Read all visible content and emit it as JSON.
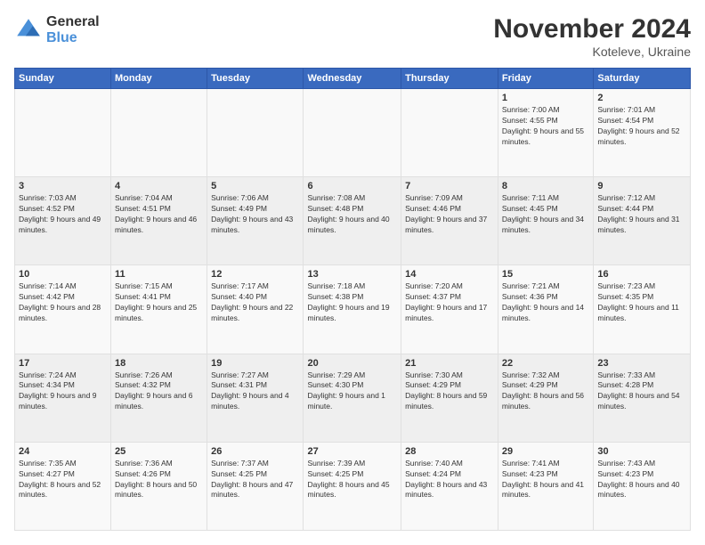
{
  "logo": {
    "general": "General",
    "blue": "Blue"
  },
  "title": "November 2024",
  "location": "Koteleve, Ukraine",
  "days_of_week": [
    "Sunday",
    "Monday",
    "Tuesday",
    "Wednesday",
    "Thursday",
    "Friday",
    "Saturday"
  ],
  "weeks": [
    [
      {
        "day": "",
        "info": ""
      },
      {
        "day": "",
        "info": ""
      },
      {
        "day": "",
        "info": ""
      },
      {
        "day": "",
        "info": ""
      },
      {
        "day": "",
        "info": ""
      },
      {
        "day": "1",
        "info": "Sunrise: 7:00 AM\nSunset: 4:55 PM\nDaylight: 9 hours and 55 minutes."
      },
      {
        "day": "2",
        "info": "Sunrise: 7:01 AM\nSunset: 4:54 PM\nDaylight: 9 hours and 52 minutes."
      }
    ],
    [
      {
        "day": "3",
        "info": "Sunrise: 7:03 AM\nSunset: 4:52 PM\nDaylight: 9 hours and 49 minutes."
      },
      {
        "day": "4",
        "info": "Sunrise: 7:04 AM\nSunset: 4:51 PM\nDaylight: 9 hours and 46 minutes."
      },
      {
        "day": "5",
        "info": "Sunrise: 7:06 AM\nSunset: 4:49 PM\nDaylight: 9 hours and 43 minutes."
      },
      {
        "day": "6",
        "info": "Sunrise: 7:08 AM\nSunset: 4:48 PM\nDaylight: 9 hours and 40 minutes."
      },
      {
        "day": "7",
        "info": "Sunrise: 7:09 AM\nSunset: 4:46 PM\nDaylight: 9 hours and 37 minutes."
      },
      {
        "day": "8",
        "info": "Sunrise: 7:11 AM\nSunset: 4:45 PM\nDaylight: 9 hours and 34 minutes."
      },
      {
        "day": "9",
        "info": "Sunrise: 7:12 AM\nSunset: 4:44 PM\nDaylight: 9 hours and 31 minutes."
      }
    ],
    [
      {
        "day": "10",
        "info": "Sunrise: 7:14 AM\nSunset: 4:42 PM\nDaylight: 9 hours and 28 minutes."
      },
      {
        "day": "11",
        "info": "Sunrise: 7:15 AM\nSunset: 4:41 PM\nDaylight: 9 hours and 25 minutes."
      },
      {
        "day": "12",
        "info": "Sunrise: 7:17 AM\nSunset: 4:40 PM\nDaylight: 9 hours and 22 minutes."
      },
      {
        "day": "13",
        "info": "Sunrise: 7:18 AM\nSunset: 4:38 PM\nDaylight: 9 hours and 19 minutes."
      },
      {
        "day": "14",
        "info": "Sunrise: 7:20 AM\nSunset: 4:37 PM\nDaylight: 9 hours and 17 minutes."
      },
      {
        "day": "15",
        "info": "Sunrise: 7:21 AM\nSunset: 4:36 PM\nDaylight: 9 hours and 14 minutes."
      },
      {
        "day": "16",
        "info": "Sunrise: 7:23 AM\nSunset: 4:35 PM\nDaylight: 9 hours and 11 minutes."
      }
    ],
    [
      {
        "day": "17",
        "info": "Sunrise: 7:24 AM\nSunset: 4:34 PM\nDaylight: 9 hours and 9 minutes."
      },
      {
        "day": "18",
        "info": "Sunrise: 7:26 AM\nSunset: 4:32 PM\nDaylight: 9 hours and 6 minutes."
      },
      {
        "day": "19",
        "info": "Sunrise: 7:27 AM\nSunset: 4:31 PM\nDaylight: 9 hours and 4 minutes."
      },
      {
        "day": "20",
        "info": "Sunrise: 7:29 AM\nSunset: 4:30 PM\nDaylight: 9 hours and 1 minute."
      },
      {
        "day": "21",
        "info": "Sunrise: 7:30 AM\nSunset: 4:29 PM\nDaylight: 8 hours and 59 minutes."
      },
      {
        "day": "22",
        "info": "Sunrise: 7:32 AM\nSunset: 4:29 PM\nDaylight: 8 hours and 56 minutes."
      },
      {
        "day": "23",
        "info": "Sunrise: 7:33 AM\nSunset: 4:28 PM\nDaylight: 8 hours and 54 minutes."
      }
    ],
    [
      {
        "day": "24",
        "info": "Sunrise: 7:35 AM\nSunset: 4:27 PM\nDaylight: 8 hours and 52 minutes."
      },
      {
        "day": "25",
        "info": "Sunrise: 7:36 AM\nSunset: 4:26 PM\nDaylight: 8 hours and 50 minutes."
      },
      {
        "day": "26",
        "info": "Sunrise: 7:37 AM\nSunset: 4:25 PM\nDaylight: 8 hours and 47 minutes."
      },
      {
        "day": "27",
        "info": "Sunrise: 7:39 AM\nSunset: 4:25 PM\nDaylight: 8 hours and 45 minutes."
      },
      {
        "day": "28",
        "info": "Sunrise: 7:40 AM\nSunset: 4:24 PM\nDaylight: 8 hours and 43 minutes."
      },
      {
        "day": "29",
        "info": "Sunrise: 7:41 AM\nSunset: 4:23 PM\nDaylight: 8 hours and 41 minutes."
      },
      {
        "day": "30",
        "info": "Sunrise: 7:43 AM\nSunset: 4:23 PM\nDaylight: 8 hours and 40 minutes."
      }
    ]
  ]
}
